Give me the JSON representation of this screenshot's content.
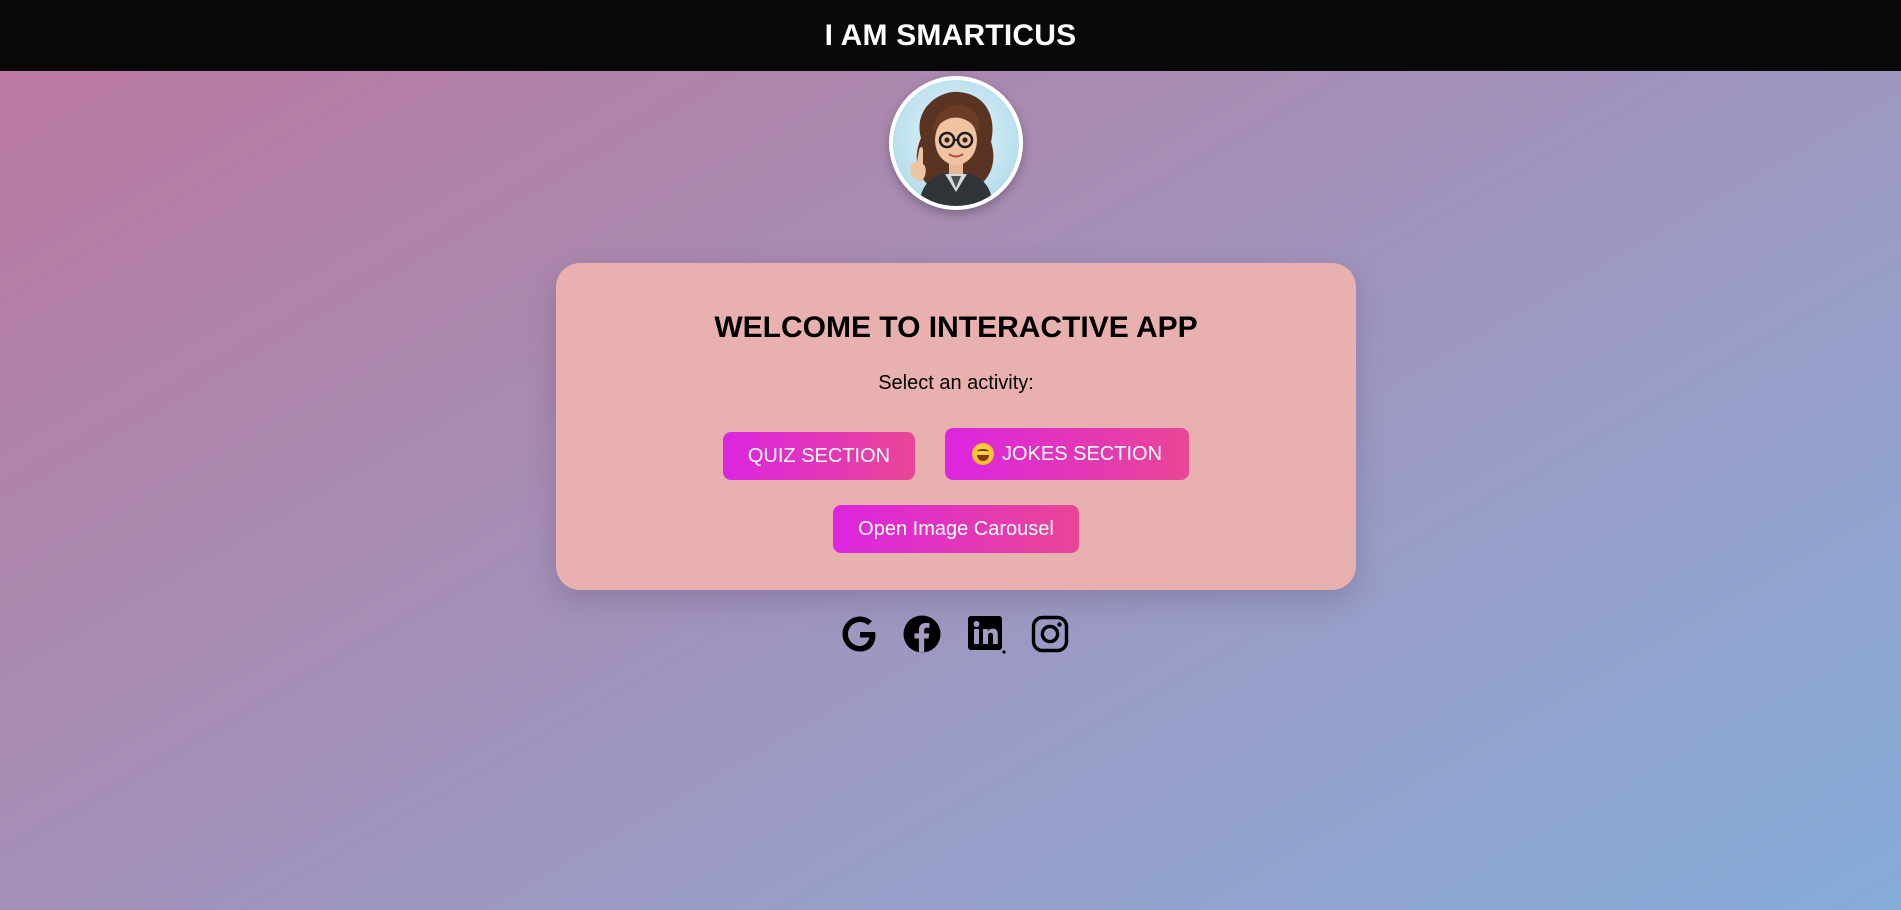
{
  "header": {
    "title": "I AM SMARTICUS"
  },
  "avatar": {
    "icon": "cartoon-woman-avatar"
  },
  "card": {
    "title": "WELCOME TO INTERACTIVE APP",
    "subtitle": "Select an activity:",
    "buttons": {
      "quiz_label": "QUIZ SECTION",
      "jokes_label": "JOKES SECTION",
      "jokes_icon": "laughing-emoji",
      "carousel_label": "Open Image Carousel"
    }
  },
  "socials": [
    {
      "name": "google-icon"
    },
    {
      "name": "facebook-icon"
    },
    {
      "name": "linkedin-icon"
    },
    {
      "name": "instagram-icon"
    }
  ],
  "colors": {
    "header_bg": "#080808",
    "card_bg": "#e8b0ae",
    "button_gradient_start": "#dc25e0",
    "button_gradient_end": "#e84696"
  }
}
